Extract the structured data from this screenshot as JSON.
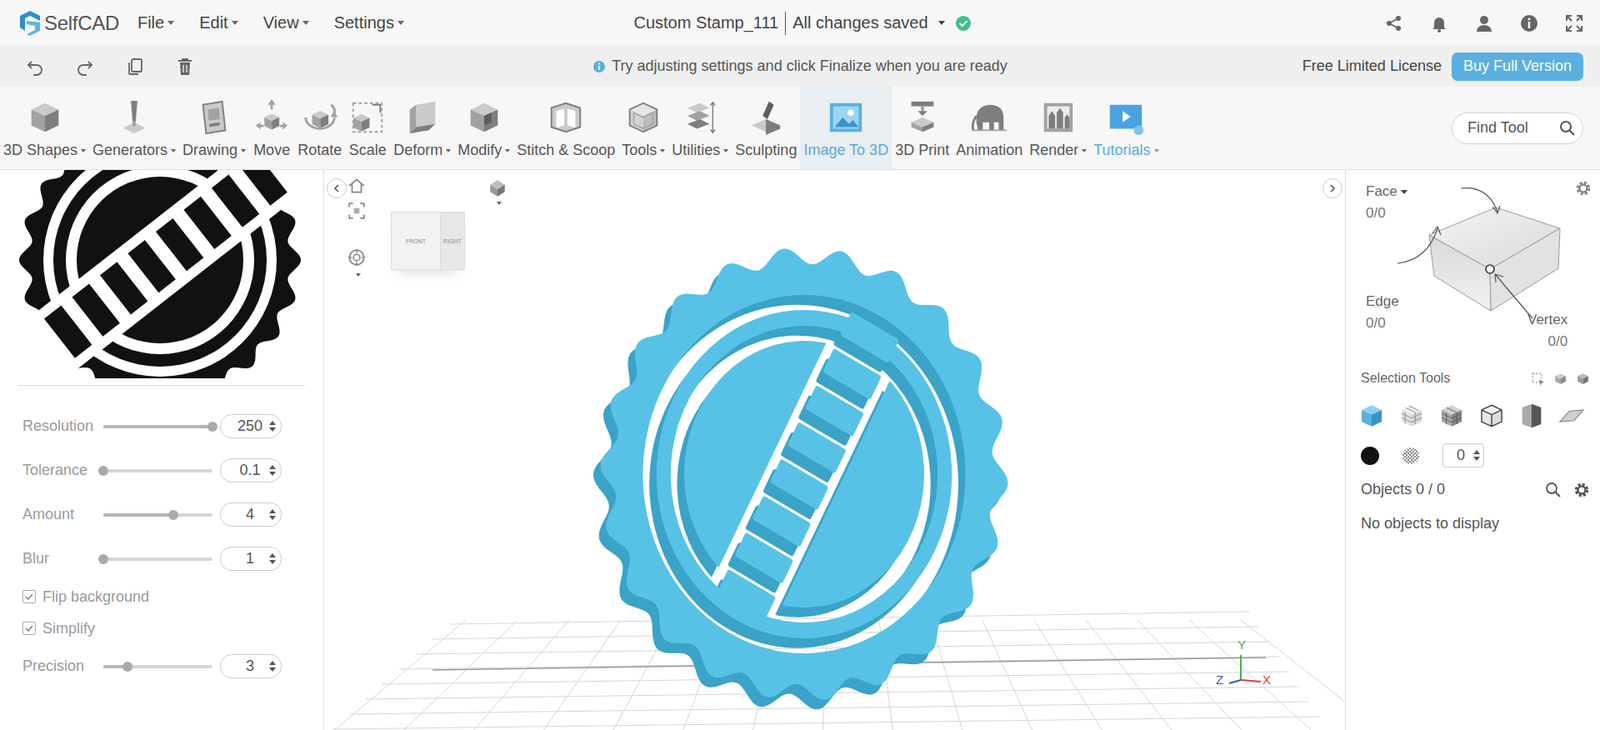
{
  "header": {
    "logo": "SelfCAD",
    "menus": [
      {
        "label": "File"
      },
      {
        "label": "Edit"
      },
      {
        "label": "View"
      },
      {
        "label": "Settings"
      }
    ],
    "project_title": "Custom Stamp_111",
    "save_status": "All changes saved",
    "saved": true
  },
  "action_bar": {
    "hint": "Try adjusting settings and click Finalize when you are ready",
    "license": "Free Limited License",
    "buy_button": "Buy Full Version"
  },
  "toolbar": {
    "tools": [
      {
        "label": "3D Shapes",
        "dropdown": true,
        "selected": false,
        "accent": false
      },
      {
        "label": "Generators",
        "dropdown": true,
        "selected": false,
        "accent": false
      },
      {
        "label": "Drawing",
        "dropdown": true,
        "selected": false,
        "accent": false
      },
      {
        "label": "Move",
        "dropdown": false,
        "selected": false,
        "accent": false
      },
      {
        "label": "Rotate",
        "dropdown": false,
        "selected": false,
        "accent": false
      },
      {
        "label": "Scale",
        "dropdown": false,
        "selected": false,
        "accent": false
      },
      {
        "label": "Deform",
        "dropdown": true,
        "selected": false,
        "accent": false
      },
      {
        "label": "Modify",
        "dropdown": true,
        "selected": false,
        "accent": false
      },
      {
        "label": "Stitch & Scoop",
        "dropdown": false,
        "selected": false,
        "accent": false
      },
      {
        "label": "Tools",
        "dropdown": true,
        "selected": false,
        "accent": false
      },
      {
        "label": "Utilities",
        "dropdown": true,
        "selected": false,
        "accent": false
      },
      {
        "label": "Sculpting",
        "dropdown": false,
        "selected": false,
        "accent": false
      },
      {
        "label": "Image To 3D",
        "dropdown": false,
        "selected": true,
        "accent": false
      },
      {
        "label": "3D Print",
        "dropdown": false,
        "selected": false,
        "accent": false
      },
      {
        "label": "Animation",
        "dropdown": false,
        "selected": false,
        "accent": false
      },
      {
        "label": "Render",
        "dropdown": true,
        "selected": false,
        "accent": false
      },
      {
        "label": "Tutorials",
        "dropdown": true,
        "selected": false,
        "accent": true
      }
    ],
    "search": {
      "placeholder": "Find Tool"
    }
  },
  "image_to_3d_panel": {
    "params": [
      {
        "kind": "slider",
        "label": "Resolution",
        "value": "250",
        "level": 1,
        "checked": false
      },
      {
        "kind": "slider",
        "label": "Tolerance",
        "value": "0.1",
        "level": 0,
        "checked": false
      },
      {
        "kind": "slider",
        "label": "Amount",
        "value": "4",
        "level": 0.64,
        "checked": false
      },
      {
        "kind": "slider",
        "label": "Blur",
        "value": "1",
        "level": 0,
        "checked": false
      },
      {
        "kind": "checkbox",
        "label": "Flip background",
        "value": "",
        "level": 0,
        "checked": true
      },
      {
        "kind": "checkbox",
        "label": "Simplify",
        "value": "",
        "level": 0,
        "checked": true
      },
      {
        "kind": "slider",
        "label": "Precision",
        "value": "3",
        "level": 0.22,
        "checked": false
      }
    ]
  },
  "viewport": {
    "view_cube": {
      "front": "FRONT",
      "right": "RIGHT"
    },
    "axes": [
      {
        "label": "Y",
        "color": "#4caf50"
      },
      {
        "label": "Z",
        "color": "#3f51b5"
      },
      {
        "label": "X",
        "color": "#e53935"
      }
    ]
  },
  "selection_panel": {
    "face": {
      "label": "Face",
      "count": "0/0"
    },
    "edge": {
      "label": "Edge",
      "count": "0/0"
    },
    "vertex": {
      "label": "Vertex",
      "count": "0/0"
    },
    "selection_tools_label": "Selection Tools",
    "selection_tools": [
      {
        "selected": true
      },
      {
        "selected": false
      },
      {
        "selected": false
      },
      {
        "selected": false
      },
      {
        "selected": false
      },
      {
        "selected": false
      }
    ],
    "material_color": "#111111",
    "count": "0",
    "objects_label": "Objects 0 / 0",
    "empty_message": "No objects to display"
  }
}
